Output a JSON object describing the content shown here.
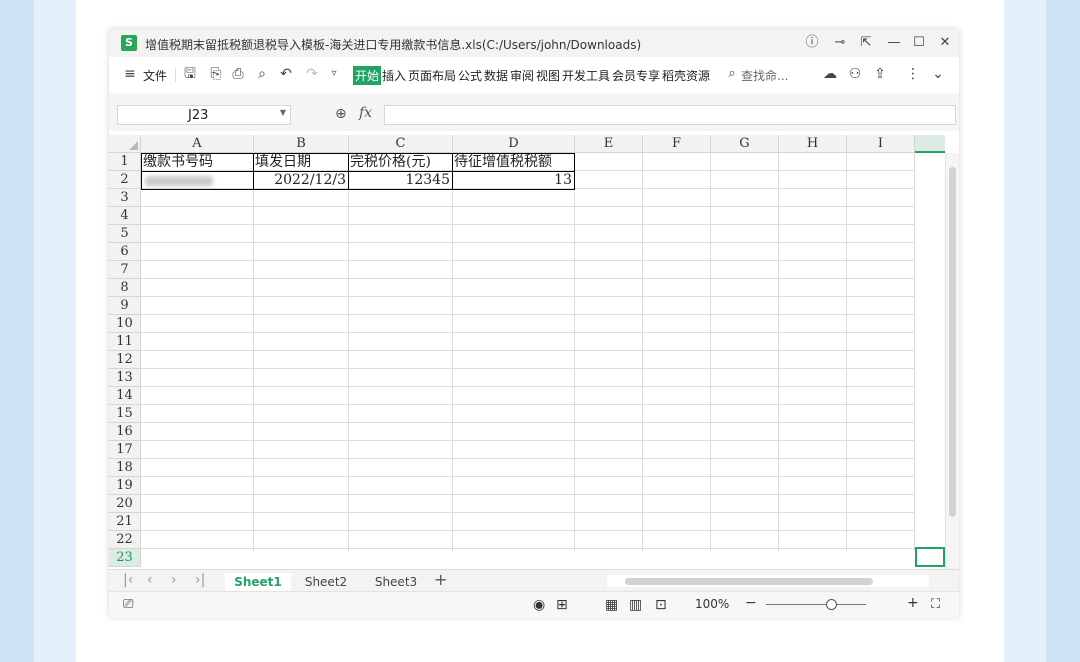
{
  "window": {
    "title": "增值税期末留抵税额退税导入模板-海关进口专用缴款书信息.xls(C:/Users/john/Downloads)",
    "app_icon_letter": "S"
  },
  "title_controls": {
    "info_icon": "ⓘ",
    "pin_icon": "⊸",
    "restore_icon": "⇱",
    "minimize_icon": "—",
    "maximize_icon": "☐",
    "close_icon": "✕"
  },
  "menubar": {
    "file_label": "文件",
    "active_tab": "开始",
    "tabs": [
      "插入",
      "页面布局",
      "公式",
      "数据",
      "审阅",
      "视图",
      "开发工具",
      "会员专享",
      "稻壳资源"
    ],
    "search_placeholder": "查找命..."
  },
  "formula_bar": {
    "name_box": "J23",
    "fx": "fx",
    "formula": ""
  },
  "columns": [
    "A",
    "B",
    "C",
    "D",
    "E",
    "F",
    "G",
    "H",
    "I"
  ],
  "rows": [
    "1",
    "2",
    "3",
    "4",
    "5",
    "6",
    "7",
    "8",
    "9",
    "10",
    "11",
    "12",
    "13",
    "14",
    "15",
    "16",
    "17",
    "18",
    "19",
    "20",
    "21",
    "22",
    "23"
  ],
  "cells": {
    "A1": "缴款书号码",
    "B1": "填发日期",
    "C1": "完税价格(元)",
    "D1": "待征增值税税额",
    "B2": "2022/12/3",
    "C2": "12345",
    "D2": "13"
  },
  "sheet_tabs": [
    "Sheet1",
    "Sheet2",
    "Sheet3"
  ],
  "status": {
    "zoom": "100%"
  }
}
